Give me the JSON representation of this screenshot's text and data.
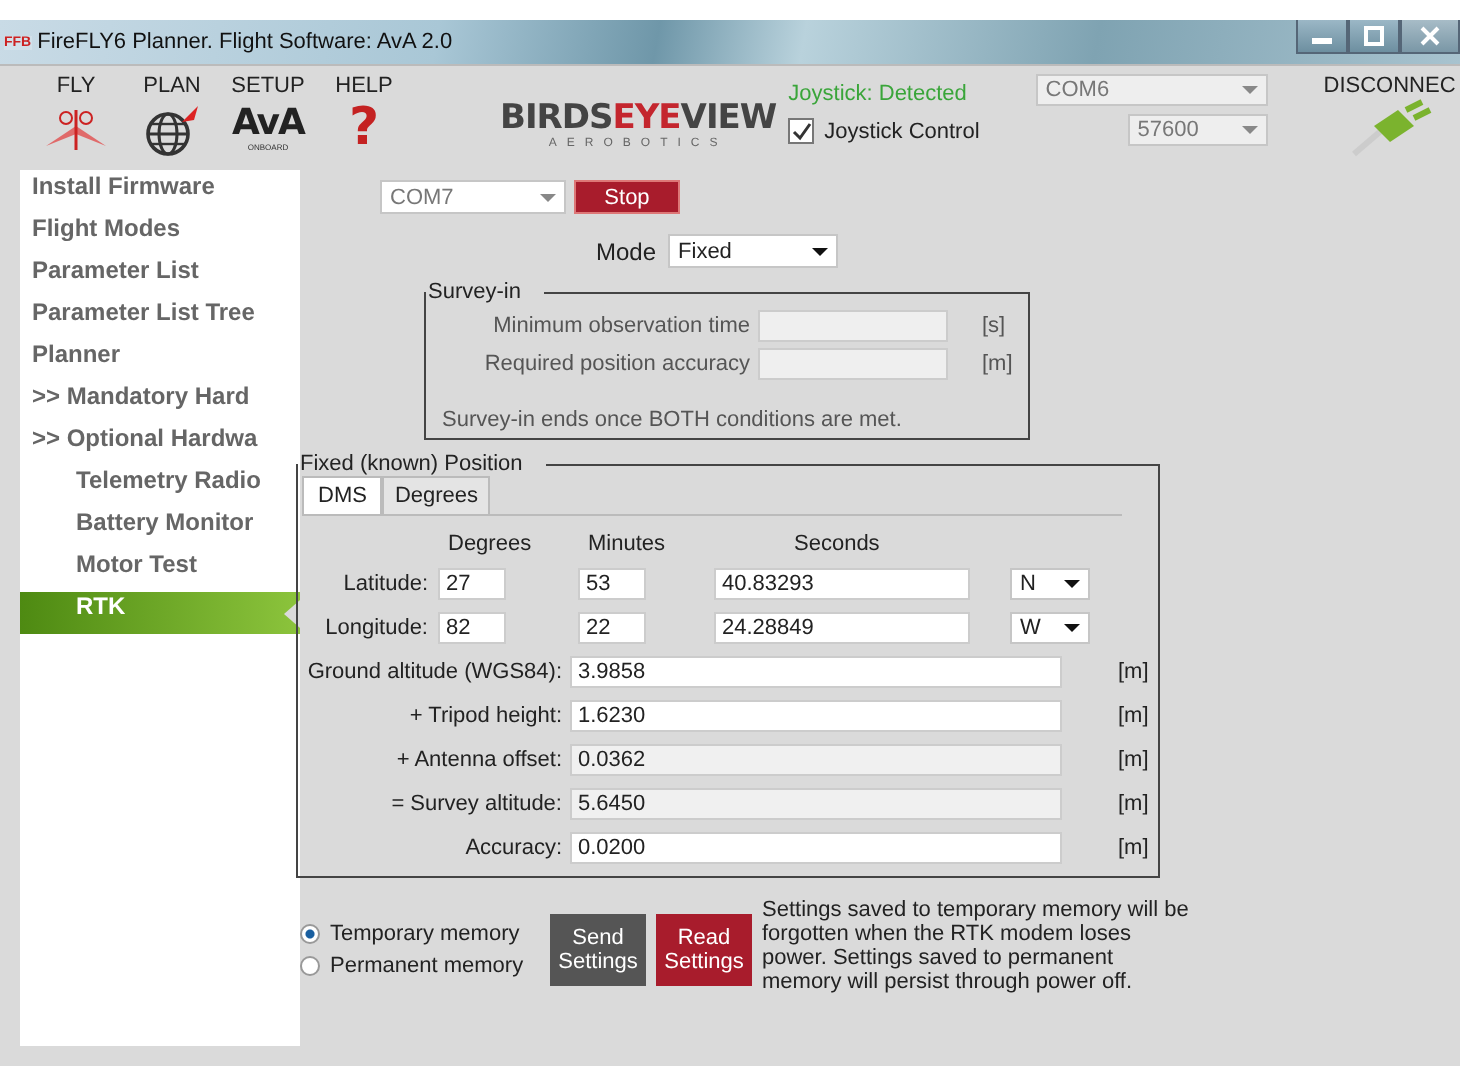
{
  "window": {
    "app_badge": "FFB",
    "title": "FireFLY6 Planner. Flight Software: AvA 2.0"
  },
  "menu": [
    {
      "label": "FLY",
      "kind": "drone"
    },
    {
      "label": "PLAN",
      "kind": "globe"
    },
    {
      "label": "SETUP",
      "kind": "ava",
      "badge_text": "AvA",
      "badge_caption": "ONBOARD"
    },
    {
      "label": "HELP",
      "kind": "help",
      "icon_char": "?"
    }
  ],
  "logo": {
    "parts": [
      "BIRDS",
      "EYE",
      "VIEW"
    ],
    "tagline": "AEROBOTICS"
  },
  "joystick": {
    "status": "Joystick: Detected",
    "control_label": "Joystick Control",
    "checked": true
  },
  "connection": {
    "port": "COM6",
    "baud": "57600",
    "action": "DISCONNEC"
  },
  "sidebar": {
    "items": [
      {
        "label": "Install Firmware",
        "selected": false
      },
      {
        "label": "Flight Modes",
        "selected": false
      },
      {
        "label": "Parameter List",
        "selected": false
      },
      {
        "label": "Parameter List Tree",
        "selected": false
      },
      {
        "label": "Planner",
        "selected": false
      },
      {
        "label": ">> Mandatory Hard",
        "selected": false
      },
      {
        "label": ">> Optional Hardwa",
        "selected": false,
        "children": [
          {
            "label": "Telemetry Radio",
            "selected": false
          },
          {
            "label": "Battery Monitor",
            "selected": false
          },
          {
            "label": "Motor Test",
            "selected": false
          },
          {
            "label": "RTK",
            "selected": true
          }
        ]
      }
    ]
  },
  "rtk": {
    "port": "COM7",
    "stop": "Stop",
    "mode_label": "Mode",
    "mode": "Fixed",
    "survey_in": {
      "title": "Survey-in",
      "fields": [
        {
          "label": "Minimum observation time",
          "unit": "[s]"
        },
        {
          "label": "Required position accuracy",
          "unit": "[m]"
        }
      ],
      "note": "Survey-in ends once BOTH conditions are met."
    },
    "fixed": {
      "title": "Fixed (known) Position",
      "tabs": [
        {
          "label": "DMS",
          "selected": true
        },
        {
          "label": "Degrees",
          "selected": false
        }
      ],
      "headers": [
        "Degrees",
        "Minutes",
        "Seconds"
      ],
      "coords": [
        {
          "label": "Latitude:",
          "degrees": "27",
          "minutes": "53",
          "seconds": "40.83293",
          "hemisphere": "N"
        },
        {
          "label": "Longitude:",
          "degrees": "82",
          "minutes": "22",
          "seconds": "24.28849",
          "hemisphere": "W"
        }
      ],
      "rows": [
        {
          "label": "Ground altitude (WGS84):",
          "value": "3.9858",
          "unit": "[m]",
          "readonly": false
        },
        {
          "label": "+ Tripod height:",
          "value": "1.6230",
          "unit": "[m]",
          "readonly": false
        },
        {
          "label": "+ Antenna offset:",
          "value": "0.0362",
          "unit": "[m]",
          "readonly": true
        },
        {
          "label": "= Survey altitude:",
          "value": "5.6450",
          "unit": "[m]",
          "readonly": true
        },
        {
          "label": "Accuracy:",
          "value": "0.0200",
          "unit": "[m]",
          "readonly": false
        }
      ]
    },
    "memory": [
      {
        "label": "Temporary memory",
        "selected": true
      },
      {
        "label": "Permanent memory",
        "selected": false
      }
    ],
    "buttons": [
      {
        "label": "Send Settings",
        "kind": "send"
      },
      {
        "label": "Read Settings",
        "kind": "read"
      }
    ],
    "note": "Settings saved to temporary memory will be forgotten when the RTK modem loses power. Settings saved to permanent memory will persist through power off."
  }
}
